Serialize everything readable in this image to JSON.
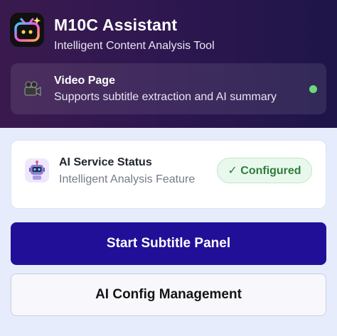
{
  "header": {
    "title": "M10C Assistant",
    "subtitle": "Intelligent Content Analysis Tool",
    "logo_icon": "tv-robot-icon"
  },
  "page_status": {
    "icon": "video-camera-icon",
    "title": "Video Page",
    "description": "Supports subtitle extraction and AI summary",
    "indicator_color": "#6dd87a"
  },
  "ai_service": {
    "icon": "robot-icon",
    "title": "AI Service Status",
    "description": "Intelligent Analysis Feature",
    "badge": "✓ Configured"
  },
  "actions": {
    "start_subtitle_panel": "Start Subtitle Panel",
    "ai_config_management": "AI Config Management"
  },
  "colors": {
    "primary_button": "#220f98",
    "success": "#2e7d3e"
  }
}
